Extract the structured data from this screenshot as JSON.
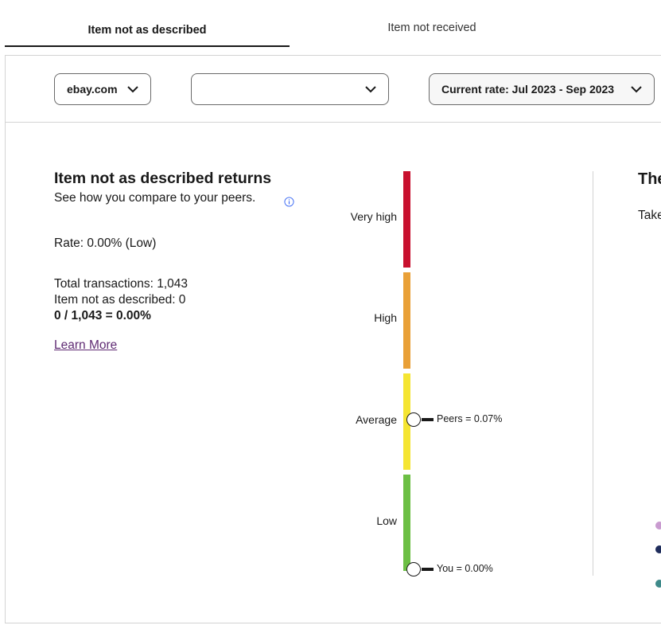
{
  "tabs": [
    {
      "label": "Item not as described",
      "active": true
    },
    {
      "label": "Item not received",
      "active": false
    }
  ],
  "filters": {
    "site": "ebay.com",
    "category": "",
    "period": "Current rate: Jul 2023 - Sep 2023"
  },
  "summary": {
    "title": "Item not as described returns",
    "subtitle": "See how you compare to your peers.",
    "rate": "Rate: 0.00% (Low)",
    "total_transactions": "Total transactions: 1,043",
    "item_not_as_described": "Item not as described: 0",
    "formula": "0 / 1,043 = 0.00%",
    "learn_more": "Learn More"
  },
  "scale": {
    "levels": [
      {
        "label": "Very high",
        "color": "#c8102e"
      },
      {
        "label": "High",
        "color": "#e9a037"
      },
      {
        "label": "Average",
        "color": "#f5e532"
      },
      {
        "label": "Low",
        "color": "#6cbf44"
      }
    ],
    "peers_label": "Peers = 0.07%",
    "you_label": "You = 0.00%"
  },
  "right_panel": {
    "title": "The",
    "text": "Take",
    "dot_colors": [
      "#c99bd0",
      "#1f2d5c",
      "#3e8a8a"
    ]
  },
  "icons": {
    "chevron": "chevron-down-icon",
    "info": "info-icon"
  }
}
